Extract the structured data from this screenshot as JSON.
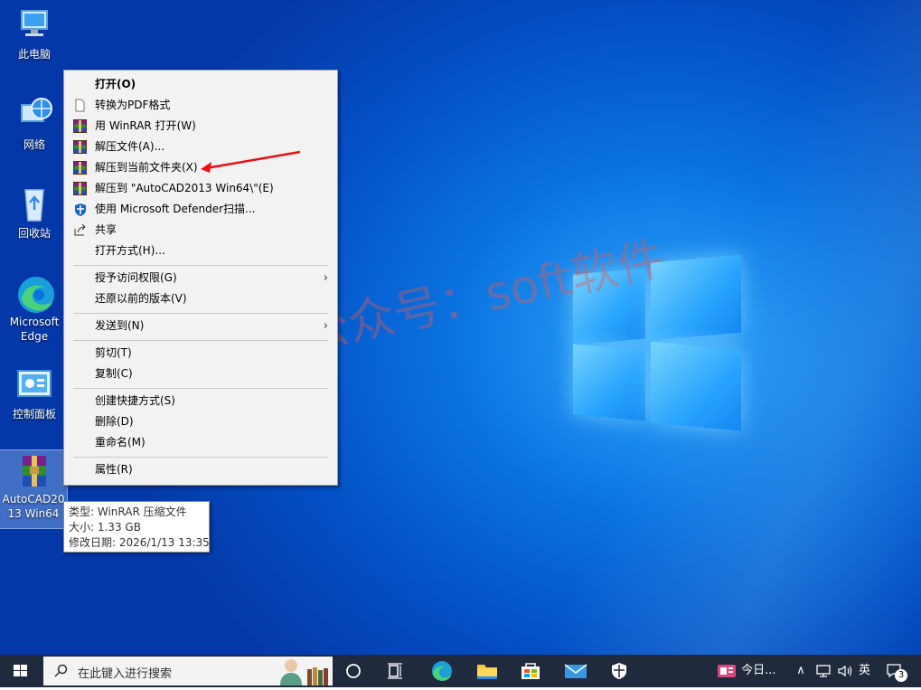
{
  "desktop": {
    "icons": [
      {
        "label": "此电脑",
        "icon": "this-pc-icon"
      },
      {
        "label": "网络",
        "icon": "network-icon"
      },
      {
        "label": "回收站",
        "icon": "recycle-bin-icon"
      },
      {
        "label": "Microsoft Edge",
        "icon": "edge-icon"
      },
      {
        "label": "控制面板",
        "icon": "control-panel-icon"
      },
      {
        "label": "AutoCAD2013 Win64",
        "icon": "winrar-archive-icon"
      }
    ],
    "watermark": "微信公众号：soft软件"
  },
  "context_menu": {
    "items": [
      {
        "label": "打开(O)",
        "bold": true
      },
      {
        "label": "转换为PDF格式",
        "icon": "document-icon"
      },
      {
        "label": "用 WinRAR 打开(W)",
        "icon": "winrar-icon"
      },
      {
        "label": "解压文件(A)...",
        "icon": "winrar-icon"
      },
      {
        "label": "解压到当前文件夹(X)",
        "icon": "winrar-icon",
        "highlighted_by_arrow": true
      },
      {
        "label": "解压到 \"AutoCAD2013 Win64\\\"(E)",
        "icon": "winrar-icon"
      },
      {
        "label": "使用 Microsoft Defender扫描...",
        "icon": "defender-icon"
      },
      {
        "label": "共享",
        "icon": "share-icon"
      },
      {
        "label": "打开方式(H)..."
      },
      {
        "label": "授予访问权限(G)",
        "submenu": true
      },
      {
        "label": "还原以前的版本(V)"
      },
      {
        "label": "发送到(N)",
        "submenu": true
      },
      {
        "label": "剪切(T)"
      },
      {
        "label": "复制(C)"
      },
      {
        "label": "创建快捷方式(S)"
      },
      {
        "label": "删除(D)"
      },
      {
        "label": "重命名(M)"
      },
      {
        "label": "属性(R)"
      }
    ]
  },
  "tooltip": {
    "type_line": "类型: WinRAR 压缩文件",
    "size_line": "大小: 1.33 GB",
    "date_line": "修改日期: 2026/1/13 13:35"
  },
  "taskbar": {
    "search_placeholder": "在此键入进行搜索",
    "news_label": "今日...",
    "ime_label": "英",
    "notification_count": "3"
  },
  "colors": {
    "annotation_arrow": "#e81010",
    "menu_bg": "#f2f2f2",
    "taskbar_bg": "#1f2a3d"
  }
}
